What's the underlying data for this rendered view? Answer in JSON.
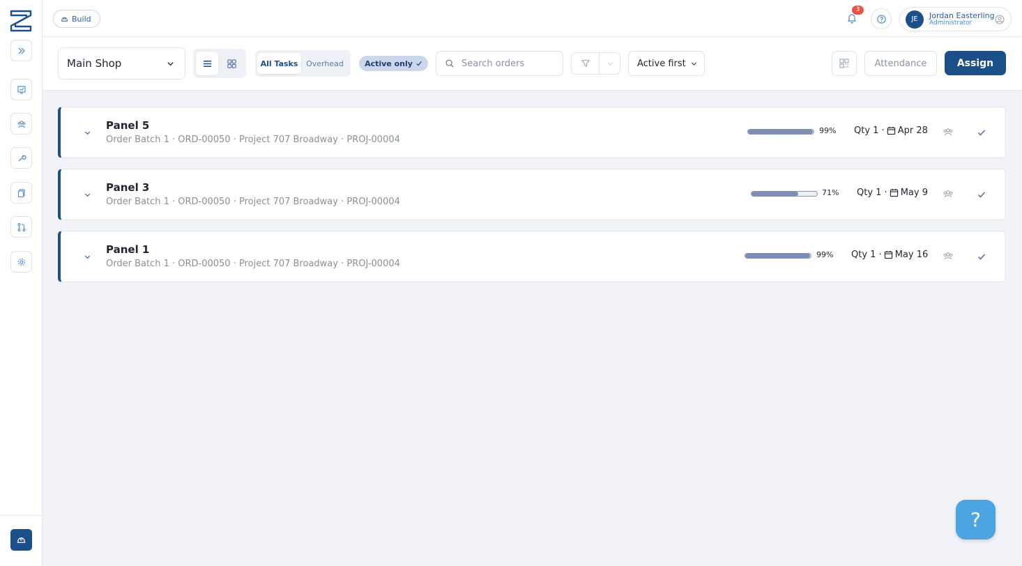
{
  "header": {
    "build_label": "Build",
    "notification_count": "3",
    "user": {
      "initials": "JE",
      "name": "Jordan Easterling",
      "role": "Administrator"
    }
  },
  "toolbar": {
    "shop": "Main Shop",
    "segments": {
      "all": "All Tasks",
      "overhead": "Overhead"
    },
    "active_filter": "Active only",
    "search_placeholder": "Search orders",
    "sort": "Active first",
    "attendance": "Attendance",
    "assign": "Assign"
  },
  "orders": [
    {
      "title": "Panel 5",
      "subtitle": "Order Batch 1 · ORD-00050 · Project 707 Broadway · PROJ-00004",
      "progress": 99,
      "progress_label": "99%",
      "qty": "Qty 1 ·",
      "date": "Apr 28"
    },
    {
      "title": "Panel 3",
      "subtitle": "Order Batch 1 · ORD-00050 · Project 707 Broadway · PROJ-00004",
      "progress": 71,
      "progress_label": "71%",
      "qty": "Qty 1 ·",
      "date": "May 9"
    },
    {
      "title": "Panel 1",
      "subtitle": "Order Batch 1 · ORD-00050 · Project 707 Broadway · PROJ-00004",
      "progress": 99,
      "progress_label": "99%",
      "qty": "Qty 1 ·",
      "date": "May 16"
    }
  ],
  "help_fab": "?",
  "colors": {
    "accent": "#1a4f8a",
    "progress_fill": "#7d8db3",
    "badge": "#e5534b",
    "fab": "#4aa5e2"
  }
}
